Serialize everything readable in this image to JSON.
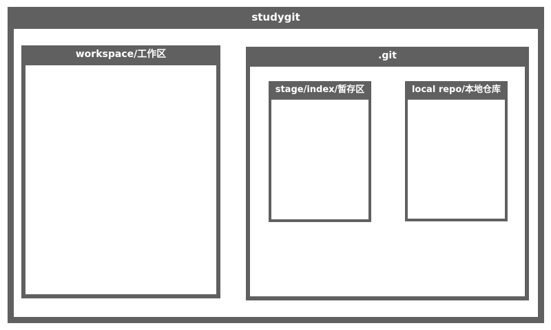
{
  "diagram": {
    "outer": {
      "label": "studygit"
    },
    "workspace": {
      "label": "workspace/工作区"
    },
    "git": {
      "label": ".git"
    },
    "stage": {
      "label": "stage/index/暂存区"
    },
    "local_repo": {
      "label": "local repo/本地仓库"
    }
  }
}
